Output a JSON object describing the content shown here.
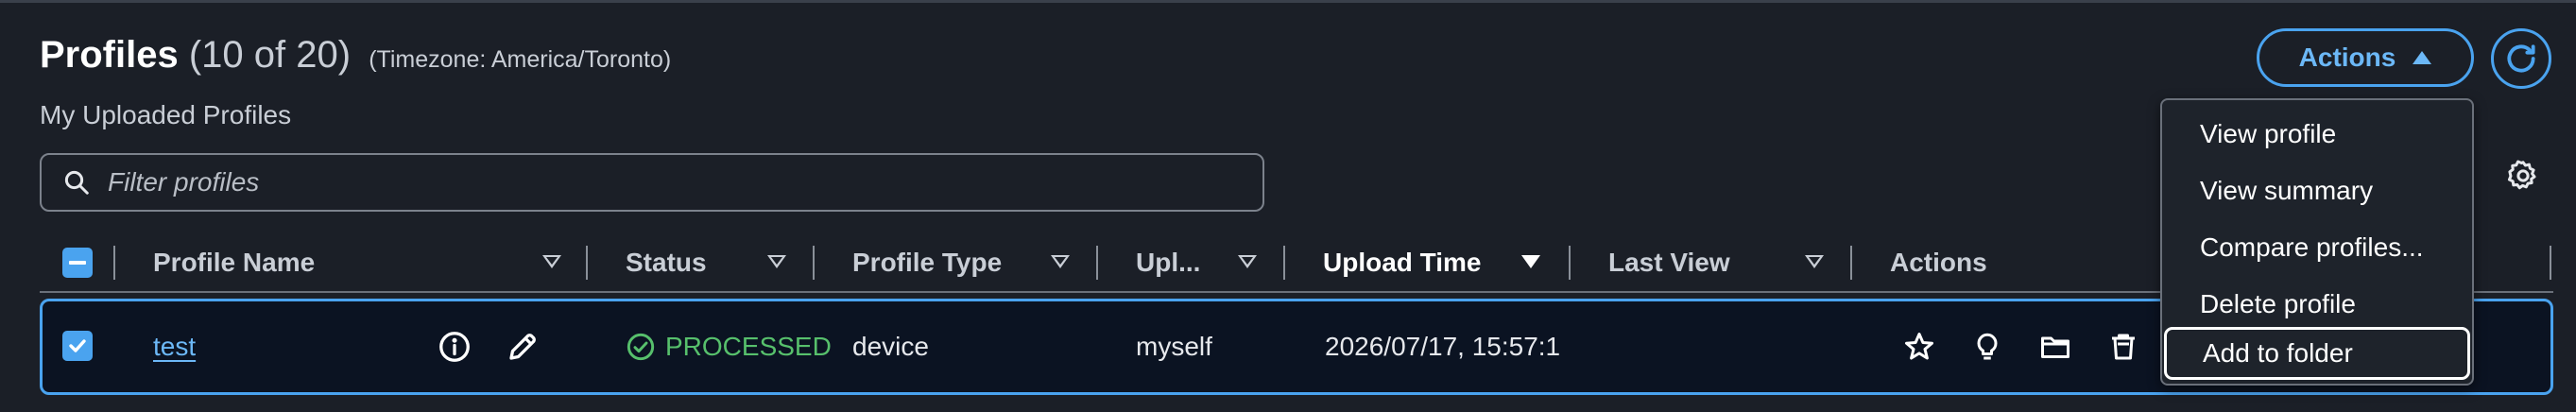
{
  "header": {
    "title": "Profiles",
    "count": "(10 of 20)",
    "timezone": "(Timezone: America/Toronto)",
    "subtitle": "My Uploaded Profiles",
    "actions_label": "Actions"
  },
  "filter": {
    "placeholder": "Filter profiles",
    "value": ""
  },
  "columns": [
    {
      "label": "Profile Name",
      "sort": "none"
    },
    {
      "label": "Status",
      "sort": "none"
    },
    {
      "label": "Profile Type",
      "sort": "none"
    },
    {
      "label": "Upl...",
      "sort": "none"
    },
    {
      "label": "Upload Time",
      "sort": "descending"
    },
    {
      "label": "Last View",
      "sort": "none"
    },
    {
      "label": "Actions"
    }
  ],
  "rows": [
    {
      "selected": true,
      "name": "test",
      "status": "PROCESSED",
      "type": "device",
      "uploader": "myself",
      "upload_time": "2026/07/17, 15:57:1"
    }
  ],
  "menu": {
    "items": [
      {
        "label": "View profile"
      },
      {
        "label": "View summary"
      },
      {
        "label": "Compare profiles..."
      },
      {
        "label": "Delete profile"
      },
      {
        "label": "Add to folder"
      }
    ],
    "focused_index": 4
  },
  "colors": {
    "background": "#1b1f27",
    "accent": "#4aa3ef",
    "link": "#6cb8f7",
    "status_processed": "#57c06c",
    "row_selected_bg": "#0b1322"
  },
  "icons": [
    "search-icon",
    "refresh-icon",
    "settings-gear-icon",
    "info-icon",
    "edit-pencil-icon",
    "check-circle-icon",
    "star-icon",
    "lightbulb-icon",
    "folder-icon",
    "trash-icon",
    "filter-icon",
    "sort-triangle-icon"
  ]
}
